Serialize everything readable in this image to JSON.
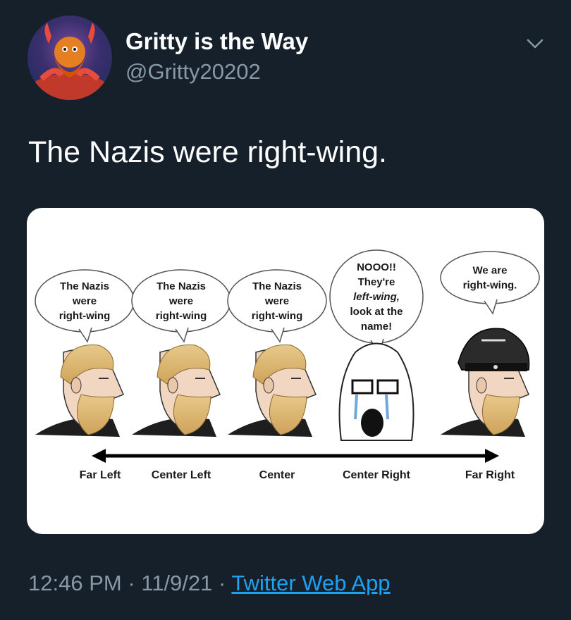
{
  "author": {
    "display_name": "Gritty is the Way",
    "handle": "@Gritty20202",
    "avatar_icon": "gritty-avatar-icon"
  },
  "menu": {
    "icon": "chevron-down-icon"
  },
  "tweet": {
    "text": "The Nazis were right-wing."
  },
  "meme": {
    "characters": [
      {
        "type": "chad",
        "bubble_lines": [
          "The Nazis",
          "were",
          "right-wing"
        ],
        "label": "Far Left"
      },
      {
        "type": "chad",
        "bubble_lines": [
          "The Nazis",
          "were",
          "right-wing"
        ],
        "label": "Center Left"
      },
      {
        "type": "chad",
        "bubble_lines": [
          "The Nazis",
          "were",
          "right-wing"
        ],
        "label": "Center"
      },
      {
        "type": "crying-soyjak",
        "bubble_lines": [
          "NOOO!!",
          "They're",
          "left-wing,",
          "look at the",
          "name!"
        ],
        "label": "Center Right"
      },
      {
        "type": "chad-officer",
        "bubble_lines": [
          "We are",
          "right-wing."
        ],
        "label": "Far Right"
      }
    ]
  },
  "meta": {
    "time": "12:46 PM",
    "sep1": " · ",
    "date": "11/9/21",
    "sep2": " · ",
    "source": "Twitter Web App"
  },
  "colors": {
    "background": "#15202b",
    "secondary_text": "#8899a6",
    "link": "#1da1f2",
    "card": "#ffffff"
  }
}
